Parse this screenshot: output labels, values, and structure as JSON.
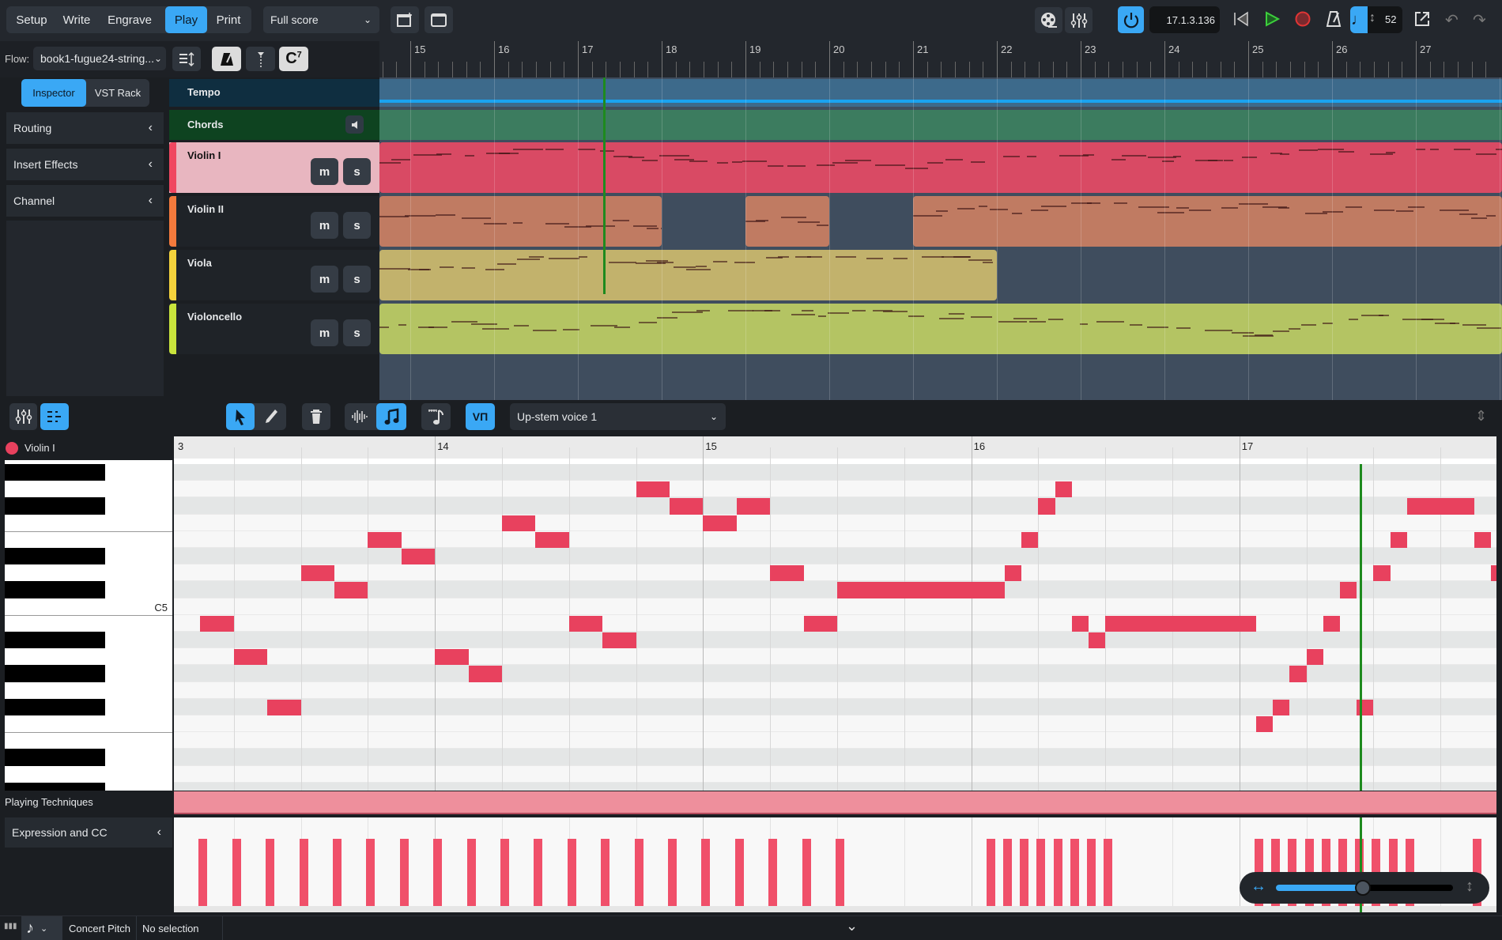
{
  "toolbar": {
    "modes": [
      {
        "label": "Setup"
      },
      {
        "label": "Write"
      },
      {
        "label": "Engrave"
      },
      {
        "label": "Play",
        "active": true
      },
      {
        "label": "Print"
      }
    ],
    "layout_select": "Full score",
    "timecode": "17.1.3.136",
    "tempo": "52",
    "icons": [
      "add-window-icon",
      "window-icon",
      "video-icon",
      "mixer-icon",
      "activate-power-icon",
      "rewind-icon",
      "play-icon",
      "record-icon",
      "metronome-icon",
      "tempo-note-icon",
      "export-icon",
      "undo-icon",
      "redo-icon"
    ]
  },
  "flow": {
    "label": "Flow:",
    "value": "book1-fugue24-string...",
    "chord_symbol": "C7"
  },
  "left_panel": {
    "tabs": [
      {
        "label": "Inspector",
        "active": true
      },
      {
        "label": "VST Rack"
      }
    ],
    "sections": [
      {
        "label": "Routing"
      },
      {
        "label": "Insert Effects"
      },
      {
        "label": "Channel"
      }
    ]
  },
  "ruler": {
    "bars": [
      "15",
      "16",
      "17",
      "18",
      "19",
      "20",
      "21",
      "22",
      "23",
      "24",
      "25",
      "26",
      "27"
    ]
  },
  "tracks": {
    "tempo": {
      "label": "Tempo"
    },
    "chords": {
      "label": "Chords"
    },
    "instruments": [
      {
        "label": "Violin I",
        "color": "#f04660",
        "region_color": "#d94a64",
        "selected": true,
        "regions": [
          [
            14,
            30
          ]
        ]
      },
      {
        "label": "Violin II",
        "color": "#f47a3c",
        "region_color": "#c07b62",
        "regions": [
          [
            14,
            18
          ],
          [
            19,
            20
          ],
          [
            21,
            30
          ]
        ]
      },
      {
        "label": "Viola",
        "color": "#f5d33c",
        "region_color": "#c2b26c",
        "regions": [
          [
            14,
            22
          ]
        ]
      },
      {
        "label": "Violoncello",
        "color": "#c9e43c",
        "region_color": "#b4c463",
        "regions": [
          [
            14,
            30
          ]
        ]
      }
    ],
    "mute_label": "m",
    "solo_label": "s"
  },
  "playhead_bar_position": 17.3,
  "lower_toolbar": {
    "voice_select": "Up-stem voice 1",
    "vn_label": "VΠ"
  },
  "piano_roll": {
    "instrument": "Violin I",
    "bar_labels": [
      {
        "bar": 13,
        "label": "3"
      },
      {
        "bar": 14,
        "label": "14"
      },
      {
        "bar": 15,
        "label": "15"
      },
      {
        "bar": 16,
        "label": "16"
      },
      {
        "bar": 17,
        "label": "17"
      }
    ],
    "key_label": "C5",
    "beats_per_bar": 4,
    "first_bar": 13,
    "note_color": "#e8415e",
    "notes_beats_from_bar13": [
      [
        0.5,
        0.5,
        71
      ],
      [
        1,
        0.5,
        69
      ],
      [
        1.5,
        0.5,
        66
      ],
      [
        2,
        0.5,
        74
      ],
      [
        2.5,
        0.5,
        73
      ],
      [
        3,
        0.5,
        76
      ],
      [
        3.5,
        0.5,
        75
      ],
      [
        4,
        0.5,
        69
      ],
      [
        4.5,
        0.5,
        68
      ],
      [
        5,
        0.5,
        77
      ],
      [
        5.5,
        0.5,
        76
      ],
      [
        6,
        0.5,
        71
      ],
      [
        6.5,
        0.5,
        70
      ],
      [
        7,
        0.5,
        79
      ],
      [
        7.5,
        0.5,
        78
      ],
      [
        8,
        0.5,
        77
      ],
      [
        8.5,
        0.5,
        78
      ],
      [
        9,
        0.5,
        74
      ],
      [
        9.5,
        0.5,
        71
      ],
      [
        10,
        2.5,
        73
      ],
      [
        12.5,
        0.25,
        74
      ],
      [
        12.75,
        0.25,
        76
      ],
      [
        13,
        0.25,
        78
      ],
      [
        13.25,
        0.25,
        79
      ],
      [
        13.5,
        0.25,
        71
      ],
      [
        13.75,
        0.25,
        70
      ],
      [
        14,
        2.25,
        71
      ],
      [
        16.25,
        0.25,
        65
      ],
      [
        16.5,
        0.25,
        66
      ],
      [
        16.75,
        0.25,
        68
      ],
      [
        17,
        0.25,
        69
      ],
      [
        17.25,
        0.25,
        71
      ],
      [
        17.5,
        0.25,
        73
      ],
      [
        17.75,
        0.25,
        66
      ],
      [
        18,
        0.25,
        74
      ],
      [
        18.25,
        0.25,
        76
      ],
      [
        18.5,
        1,
        78
      ],
      [
        19.5,
        0.25,
        76
      ],
      [
        19.75,
        0.25,
        74
      ]
    ],
    "playhead_beat": 17.8
  },
  "playing_techniques": {
    "label": "Playing Techniques"
  },
  "expression": {
    "label": "Expression and CC",
    "cc_events_beats": [
      0.5,
      1,
      1.5,
      2,
      2.5,
      3,
      3.5,
      4,
      4.5,
      5,
      5.5,
      6,
      6.5,
      7,
      7.5,
      8,
      8.5,
      9,
      9.5,
      10,
      12.25,
      12.5,
      12.75,
      13,
      13.25,
      13.5,
      13.75,
      14,
      16.25,
      16.5,
      16.75,
      17,
      17.25,
      17.5,
      17.75,
      18,
      18.25,
      18.5,
      19.5
    ],
    "cc_value": 96
  },
  "zoom_slider": {
    "fraction": 0.49
  },
  "status": {
    "concert_pitch": "Concert Pitch",
    "selection": "No selection"
  }
}
